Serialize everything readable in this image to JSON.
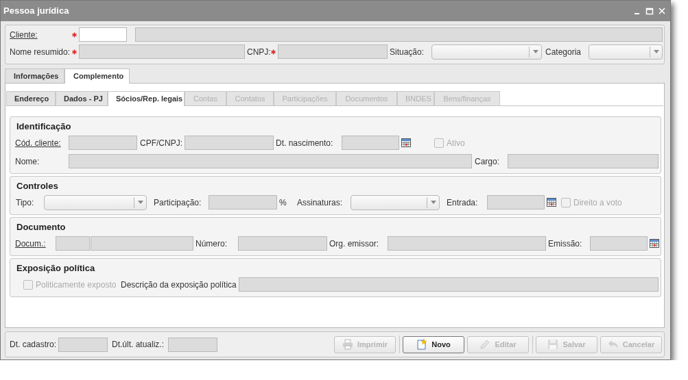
{
  "window": {
    "title": "Pessoa jurídica"
  },
  "header": {
    "rows": [
      {
        "items": [
          {
            "kind": "link",
            "text": "Cliente:"
          },
          {
            "kind": "input",
            "required": true,
            "disabled": false
          },
          {
            "kind": "input",
            "required": false,
            "disabled": true
          }
        ]
      },
      {
        "items": [
          {
            "kind": "label",
            "text": "Nome resumido:"
          },
          {
            "kind": "input",
            "required": true,
            "disabled": true
          },
          {
            "kind": "label",
            "text": "CNPJ:"
          },
          {
            "kind": "input",
            "required": true,
            "disabled": true
          },
          {
            "kind": "label",
            "text": "Situação:"
          },
          {
            "kind": "select"
          },
          {
            "kind": "label",
            "text": "Categoria"
          },
          {
            "kind": "select"
          }
        ]
      }
    ]
  },
  "tabs": [
    {
      "label": "Informações",
      "selected": false
    },
    {
      "label": "Complemento",
      "selected": true
    }
  ],
  "subtabs": [
    {
      "label": "Endereço",
      "selected": false,
      "disabled": false
    },
    {
      "label": "Dados - PJ",
      "selected": false,
      "disabled": false
    },
    {
      "label": "Sócios/Rep. legais",
      "selected": true,
      "disabled": false
    },
    {
      "label": "Contas",
      "selected": false,
      "disabled": true
    },
    {
      "label": "Contatos",
      "selected": false,
      "disabled": true
    },
    {
      "label": "Participações",
      "selected": false,
      "disabled": true
    },
    {
      "label": "Documentos",
      "selected": false,
      "disabled": true
    },
    {
      "label": "BNDES",
      "selected": false,
      "disabled": true
    },
    {
      "label": "Bens/finanças",
      "selected": false,
      "disabled": true
    }
  ],
  "sections": [
    {
      "title": "Identificação",
      "rows": [
        {
          "items": [
            {
              "kind": "link",
              "text": "Cód. cliente:"
            },
            {
              "kind": "input",
              "disabled": true
            },
            {
              "kind": "label",
              "text": "CPF/CNPJ:"
            },
            {
              "kind": "input",
              "disabled": true
            },
            {
              "kind": "label",
              "text": "Dt. nascimento:"
            },
            {
              "kind": "date",
              "disabled": true
            },
            {
              "kind": "checkbox",
              "label": "Ativo",
              "checked": false,
              "disabled": true
            }
          ]
        },
        {
          "items": [
            {
              "kind": "label",
              "text": "Nome:"
            },
            {
              "kind": "input",
              "disabled": true
            },
            {
              "kind": "label",
              "text": "Cargo:"
            },
            {
              "kind": "input",
              "disabled": true
            }
          ]
        }
      ]
    },
    {
      "title": "Controles",
      "rows": [
        {
          "items": [
            {
              "kind": "label",
              "text": "Tipo:"
            },
            {
              "kind": "select"
            },
            {
              "kind": "label",
              "text": "Participação:"
            },
            {
              "kind": "input",
              "disabled": true
            },
            {
              "kind": "label",
              "text": "%"
            },
            {
              "kind": "label",
              "text": "Assinaturas:"
            },
            {
              "kind": "select"
            },
            {
              "kind": "label",
              "text": "Entrada:"
            },
            {
              "kind": "date",
              "disabled": true
            },
            {
              "kind": "checkbox",
              "label": "Direito a voto",
              "checked": false,
              "disabled": true
            }
          ]
        }
      ]
    },
    {
      "title": "Documento",
      "rows": [
        {
          "items": [
            {
              "kind": "link",
              "text": "Docum.:"
            },
            {
              "kind": "input",
              "disabled": true
            },
            {
              "kind": "input",
              "disabled": true
            },
            {
              "kind": "label",
              "text": "Número:"
            },
            {
              "kind": "input",
              "disabled": true
            },
            {
              "kind": "label",
              "text": "Org. emissor:"
            },
            {
              "kind": "input",
              "disabled": true
            },
            {
              "kind": "label",
              "text": "Emissão:"
            },
            {
              "kind": "date",
              "disabled": true
            }
          ]
        }
      ]
    },
    {
      "title": "Exposição política",
      "rows": [
        {
          "items": [
            {
              "kind": "checkbox",
              "label": "Politicamente exposto",
              "checked": false,
              "disabled": true
            },
            {
              "kind": "label",
              "text": "Descrição da exposição política"
            },
            {
              "kind": "input",
              "disabled": true
            }
          ]
        }
      ]
    }
  ],
  "footer": {
    "items": [
      {
        "kind": "label",
        "text": "Dt. cadastro:"
      },
      {
        "kind": "input",
        "disabled": true
      },
      {
        "kind": "label",
        "text": "Dt.últ. atualiz.:"
      },
      {
        "kind": "input",
        "disabled": true
      }
    ]
  },
  "buttons": [
    {
      "label": "Imprimir",
      "disabled": true
    },
    {
      "label": "Novo",
      "disabled": false
    },
    {
      "label": "Editar",
      "disabled": true
    },
    {
      "label": "Salvar",
      "disabled": true
    },
    {
      "label": "Cancelar",
      "disabled": true
    }
  ]
}
